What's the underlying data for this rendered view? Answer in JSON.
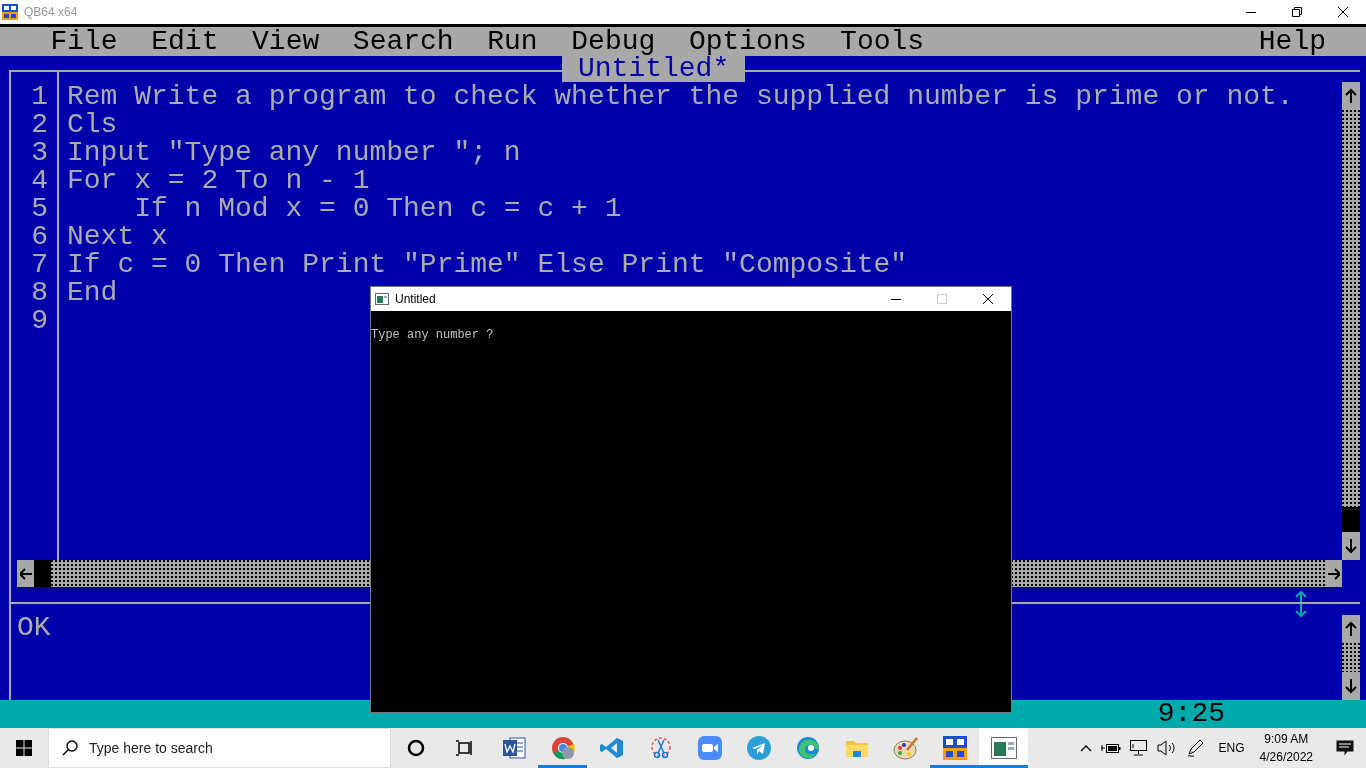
{
  "window": {
    "title": "QB64 x64"
  },
  "menu": [
    {
      "label": "File"
    },
    {
      "label": "Edit"
    },
    {
      "label": "View"
    },
    {
      "label": "Search"
    },
    {
      "label": "Run"
    },
    {
      "label": "Debug"
    },
    {
      "label": "Options"
    },
    {
      "label": "Tools"
    },
    {
      "label": "Help",
      "kind": "right"
    }
  ],
  "editor": {
    "title": "Untitled*",
    "lines": [
      {
        "number": "1",
        "text": "Rem Write a program to check whether the supplied number is prime or not."
      },
      {
        "number": "2",
        "text": "Cls"
      },
      {
        "number": "3",
        "text": "Input \"Type any number \"; n"
      },
      {
        "number": "4",
        "text": "For x = 2 To n - 1"
      },
      {
        "number": "5",
        "text": "    If n Mod x = 0 Then c = c + 1"
      },
      {
        "number": "6",
        "text": "Next x"
      },
      {
        "number": "7",
        "text": "If c = 0 Then Print \"Prime\" Else Print \"Composite\""
      },
      {
        "number": "8",
        "text": "End"
      },
      {
        "number": "9"
      }
    ]
  },
  "immediate": {
    "text": "OK"
  },
  "status_bar": {
    "clock": "9:25"
  },
  "console_window": {
    "title": "Untitled",
    "output": "Type any number ?"
  },
  "taskbar": {
    "search": {
      "placeholder": "Type here to search"
    },
    "apps": [
      {
        "kind": "cortana",
        "running": false,
        "selected": false
      },
      {
        "kind": "taskview",
        "running": false,
        "selected": false
      },
      {
        "kind": "word",
        "running": false,
        "selected": false
      },
      {
        "kind": "chrome",
        "running": true,
        "selected": false
      },
      {
        "kind": "vscode",
        "running": false,
        "selected": false
      },
      {
        "kind": "snip",
        "running": false,
        "selected": false
      },
      {
        "kind": "zoom",
        "running": false,
        "selected": false
      },
      {
        "kind": "telegram",
        "running": false,
        "selected": false
      },
      {
        "kind": "edge",
        "running": false,
        "selected": false
      },
      {
        "kind": "explorer",
        "running": false,
        "selected": false
      },
      {
        "kind": "paint",
        "running": false,
        "selected": false
      },
      {
        "kind": "qb64",
        "running": true,
        "selected": false
      },
      {
        "kind": "console",
        "running": true,
        "selected": true
      }
    ],
    "language": "ENG",
    "time": "9:09 AM",
    "date": "4/26/2022"
  }
}
